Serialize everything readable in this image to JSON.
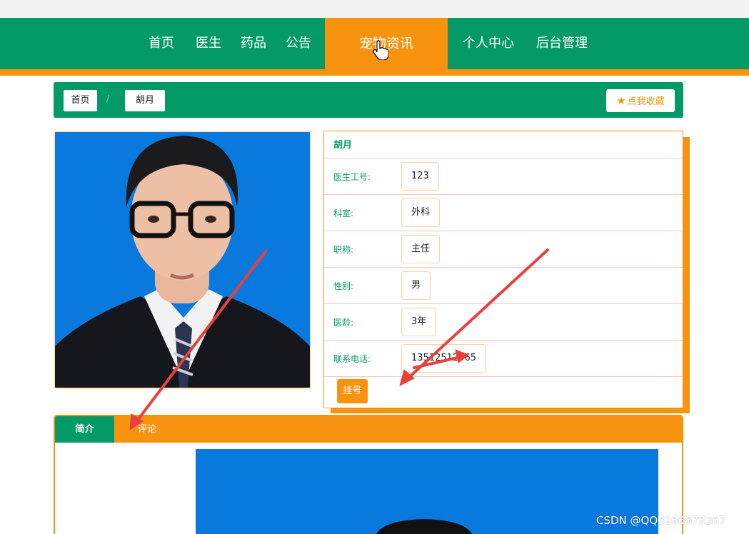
{
  "nav": {
    "items": [
      {
        "label": "首页"
      },
      {
        "label": "医生"
      },
      {
        "label": "药品"
      },
      {
        "label": "公告"
      },
      {
        "label": "宠物资讯"
      },
      {
        "label": "个人中心"
      },
      {
        "label": "后台管理"
      }
    ],
    "active": "宠物资讯"
  },
  "breadcrumb": {
    "home": "首页",
    "separator": "/",
    "current": "胡月"
  },
  "favorite": {
    "label": "点我收藏",
    "icon": "star-icon"
  },
  "doctor": {
    "name": "胡月",
    "fields": [
      {
        "label": "医生工号:",
        "value": "123"
      },
      {
        "label": "科室:",
        "value": "外科"
      },
      {
        "label": "职称:",
        "value": "主任"
      },
      {
        "label": "性别:",
        "value": "男"
      },
      {
        "label": "医龄:",
        "value": "3年"
      },
      {
        "label": "联系电话:",
        "value": "13512512565"
      }
    ],
    "register_label": "挂号"
  },
  "tabs": [
    {
      "label": "简介"
    },
    {
      "label": "评论"
    }
  ],
  "watermark": "CSDN @QQ3166678367",
  "colors": {
    "primary": "#049a68",
    "accent": "#f8930f",
    "photo_bg": "#0a79de",
    "arrow": "#e8413c"
  }
}
